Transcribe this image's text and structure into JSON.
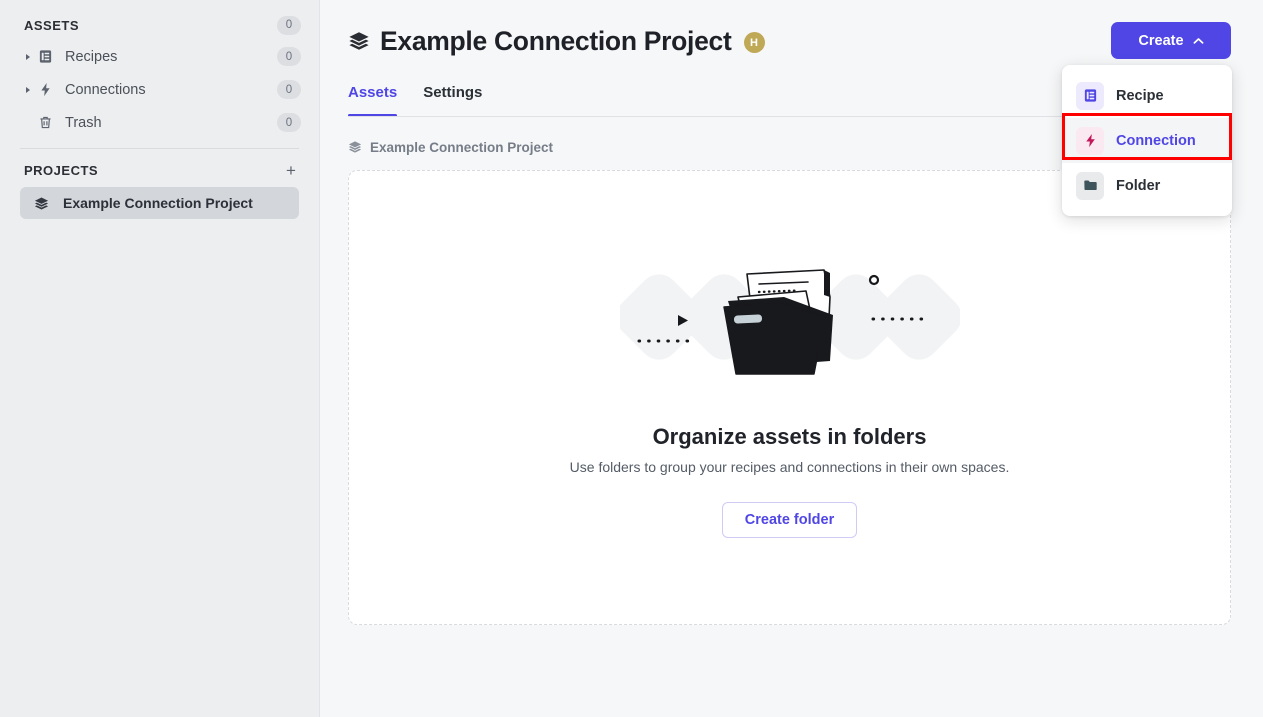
{
  "sidebar": {
    "assets_section": {
      "label": "ASSETS",
      "count": "0"
    },
    "items": [
      {
        "label": "Recipes",
        "count": "0",
        "icon": "recipe-document-icon",
        "has_caret": true
      },
      {
        "label": "Connections",
        "count": "0",
        "icon": "lightning-bolt-icon",
        "has_caret": true
      },
      {
        "label": "Trash",
        "count": "0",
        "icon": "trash-can-icon",
        "has_caret": false
      }
    ],
    "projects_section": {
      "label": "PROJECTS",
      "add_icon": "plus-icon"
    },
    "projects": [
      {
        "label": "Example Connection Project",
        "icon": "stack-layers-icon",
        "selected": true
      }
    ]
  },
  "header": {
    "title": "Example Connection Project",
    "title_icon": "stack-layers-icon",
    "avatar_initial": "H",
    "avatar_color": "#c0a956",
    "create_button": {
      "label": "Create",
      "chevron": "chevron-up-icon"
    }
  },
  "tabs": [
    {
      "label": "Assets",
      "active": true
    },
    {
      "label": "Settings",
      "active": false
    }
  ],
  "breadcrumb": {
    "icon": "stack-layers-icon",
    "text": "Example Connection Project"
  },
  "empty_state": {
    "illustration": "open-folder-with-documents-illustration",
    "title": "Organize assets in folders",
    "subtitle": "Use folders to group your recipes and connections in their own spaces.",
    "button_label": "Create folder"
  },
  "create_menu": {
    "items": [
      {
        "label": "Recipe",
        "icon": "recipe-document-icon",
        "highlighted": false
      },
      {
        "label": "Connection",
        "icon": "lightning-bolt-icon",
        "highlighted": true
      },
      {
        "label": "Folder",
        "icon": "folder-icon",
        "highlighted": false
      }
    ],
    "annotation_color": "#ff0000"
  },
  "colors": {
    "accent": "#4f46e5",
    "sidebar_bg": "#edeef0",
    "main_bg": "#f6f7f8",
    "annotation": "#ff0000"
  }
}
